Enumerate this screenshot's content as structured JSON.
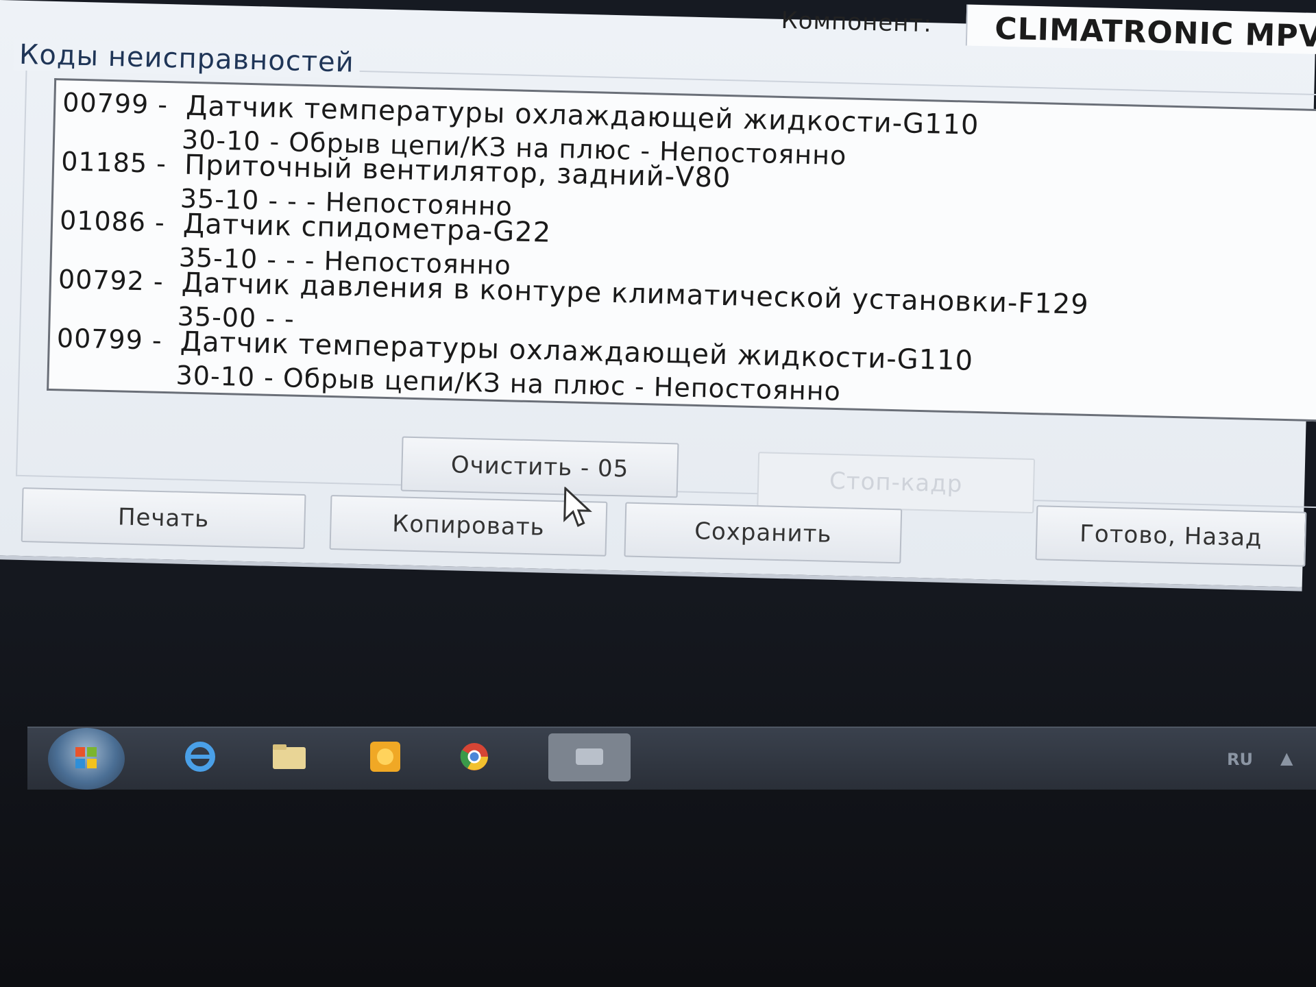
{
  "header": {
    "component_label": "Компонент:",
    "component_value": "CLIMATRONIC MPV"
  },
  "fault_group": {
    "title": "Коды неисправностей",
    "faults": [
      {
        "code": "00799 -",
        "description": "Датчик температуры охлаждающей жидкости-G110",
        "detail": "30-10 -  Обрыв цепи/КЗ на плюс - Непостоянно"
      },
      {
        "code": "01185 -",
        "description": "Приточный вентилятор, задний-V80",
        "detail": "35-10 -  - - Непостоянно"
      },
      {
        "code": "01086 -",
        "description": "Датчик спидометра-G22",
        "detail": "35-10 -  - - Непостоянно"
      },
      {
        "code": "00792 -",
        "description": "Датчик давления в контуре климатической установки-F129",
        "detail": "35-00 -  -"
      },
      {
        "code": "00799 -",
        "description": "Датчик температуры охлаждающей жидкости-G110",
        "detail": "30-10 -  Обрыв цепи/КЗ на плюс - Непостоянно"
      }
    ]
  },
  "buttons": {
    "clear": "Очистить - 05",
    "freeze_frame": "Стоп-кадр",
    "print": "Печать",
    "copy": "Копировать",
    "save": "Сохранить",
    "done_back": "Готово, Назад"
  },
  "taskbar": {
    "language": "RU",
    "tray_arrow": "▲",
    "icons": [
      "start-orb",
      "ie-icon",
      "folder-icon",
      "media-icon",
      "chrome-icon",
      "vcds-icon"
    ]
  },
  "colors": {
    "window_bg": "#eef2f7",
    "title_blue": "#1f3557",
    "taskbar": "#2a2f38"
  }
}
